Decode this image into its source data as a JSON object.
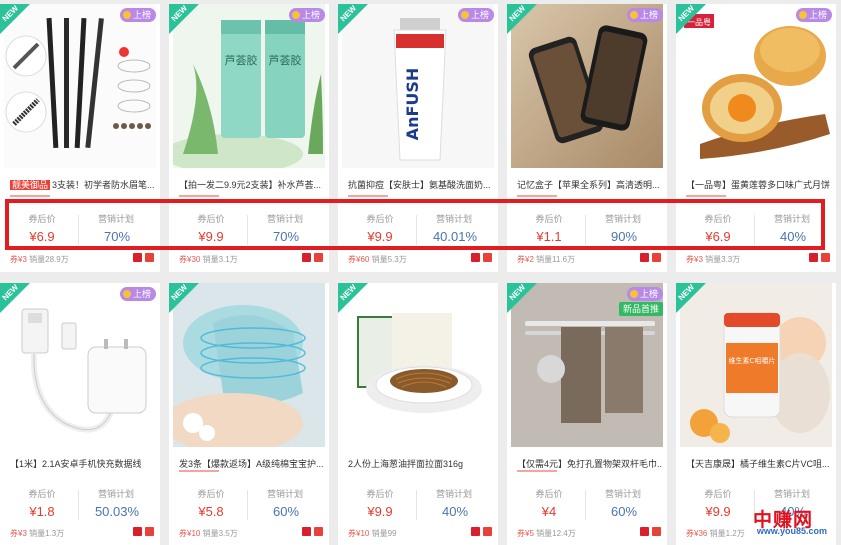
{
  "stat_labels": {
    "after_coupon": "券后价",
    "plan": "营销计划"
  },
  "badges": {
    "list": "上榜",
    "new": "NEW",
    "new_arrival": "新品首推"
  },
  "products_row1": [
    {
      "title_hot": "靓美御品",
      "title": "3支装！初学者防水眉笔...",
      "price": "¥6.9",
      "plan": "70%",
      "foot_coupon": "券¥3",
      "foot_sales": "销量28.9万"
    },
    {
      "title": "【拍一发二9.9元2支装】补水芦荟...",
      "price": "¥9.9",
      "plan": "70%",
      "foot_coupon": "券¥30",
      "foot_sales": "销量3.1万"
    },
    {
      "title": "抗菌抑痘【安肤士】氨基酸洗面奶...",
      "price": "¥9.9",
      "plan": "40.01%",
      "foot_coupon": "券¥60",
      "foot_sales": "销量5.3万"
    },
    {
      "title": "记忆盒子【苹果全系列】高清透明...",
      "price": "¥1.1",
      "plan": "90%",
      "foot_coupon": "券¥2",
      "foot_sales": "销量11.6万"
    },
    {
      "title": "【一品粤】蛋黄莲蓉多口味广式月饼",
      "price": "¥6.9",
      "plan": "40%",
      "foot_coupon": "券¥3",
      "foot_sales": "销量3.3万"
    }
  ],
  "products_row2": [
    {
      "title": "【1米】2.1A安卓手机快充数据线",
      "price": "¥1.8",
      "plan": "50.03%",
      "foot_coupon": "券¥3",
      "foot_sales": "销量1.3万"
    },
    {
      "title": "发3条【爆款返场】A级纯棉宝宝护...",
      "price": "¥5.8",
      "plan": "60%",
      "foot_coupon": "券¥10",
      "foot_sales": "销量3.5万"
    },
    {
      "title": "2人份上海葱油拌面拉面316g",
      "price": "¥9.9",
      "plan": "40%",
      "foot_coupon": "券¥10",
      "foot_sales": "销量99"
    },
    {
      "title": "【仅需4元】免打孔置物架双杆毛巾...",
      "price": "¥4",
      "plan": "60%",
      "foot_coupon": "券¥5",
      "foot_sales": "销量12.4万"
    },
    {
      "title": "【天吉康晟】橘子维生素C片VC咀...",
      "price": "¥9.9",
      "plan": "40%",
      "foot_coupon": "券¥36",
      "foot_sales": "销量1.2万"
    }
  ],
  "image_text": {
    "aloe": "芦荟胶",
    "fush": "AnFUSH",
    "mooncake_logo": "一品粤",
    "vc": "维生素C咀嚼片"
  },
  "watermark": {
    "brand": "中赚网",
    "url": "www.you85.com"
  },
  "colors": {
    "accent_red": "#e83a2b",
    "plan_blue": "#4a73b7",
    "highlight_box": "#e01e22",
    "new_tag": "#2bc29a",
    "list_badge": "#b889e6"
  }
}
